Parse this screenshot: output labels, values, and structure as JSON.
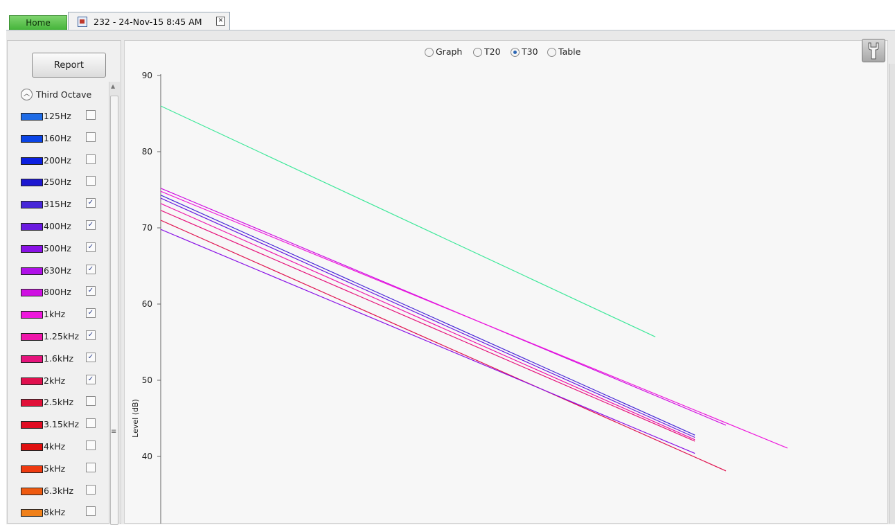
{
  "tabs": {
    "home_label": "Home",
    "document_label": "232 - 24-Nov-15 8:45 AM",
    "close_glyph": "✕"
  },
  "sidebar": {
    "report_label": "Report",
    "section_label": "Third Octave",
    "bands": [
      {
        "label": "125Hz",
        "color": "#1e6be6",
        "checked": false
      },
      {
        "label": "160Hz",
        "color": "#0a44e6",
        "checked": false
      },
      {
        "label": "200Hz",
        "color": "#0c20e0",
        "checked": false
      },
      {
        "label": "250Hz",
        "color": "#1d18d0",
        "checked": false
      },
      {
        "label": "315Hz",
        "color": "#4727d8",
        "checked": true
      },
      {
        "label": "400Hz",
        "color": "#6a1ae0",
        "checked": true
      },
      {
        "label": "500Hz",
        "color": "#8a12e6",
        "checked": true
      },
      {
        "label": "630Hz",
        "color": "#b010e8",
        "checked": true
      },
      {
        "label": "800Hz",
        "color": "#cf10e2",
        "checked": true
      },
      {
        "label": "1kHz",
        "color": "#ee18dc",
        "checked": true
      },
      {
        "label": "1.25kHz",
        "color": "#ee16aa",
        "checked": true
      },
      {
        "label": "1.6kHz",
        "color": "#e6147c",
        "checked": true
      },
      {
        "label": "2kHz",
        "color": "#e0104e",
        "checked": true
      },
      {
        "label": "2.5kHz",
        "color": "#e01038",
        "checked": false
      },
      {
        "label": "3.15kHz",
        "color": "#e00c22",
        "checked": false
      },
      {
        "label": "4kHz",
        "color": "#e01010",
        "checked": false
      },
      {
        "label": "5kHz",
        "color": "#ee3a10",
        "checked": false
      },
      {
        "label": "6.3kHz",
        "color": "#ee5a10",
        "checked": false
      },
      {
        "label": "8kHz",
        "color": "#f0801a",
        "checked": false
      }
    ]
  },
  "view_options": {
    "options": [
      "Graph",
      "T20",
      "T30",
      "Table"
    ],
    "selected": "T30"
  },
  "chart_data": {
    "type": "line",
    "ylabel": "Level (dB)",
    "ylim": [
      30,
      90
    ],
    "yticks": [
      40,
      50,
      60,
      70,
      80,
      90
    ],
    "grid": false,
    "series": [
      {
        "color": "#3ee89a",
        "x": [
          0.0,
          0.7
        ],
        "y": [
          86.0,
          55.7
        ]
      },
      {
        "color": "#cf10e2",
        "x": [
          0.0,
          0.8
        ],
        "y": [
          75.2,
          44.1
        ]
      },
      {
        "color": "#ee18dc",
        "x": [
          0.0,
          0.887
        ],
        "y": [
          74.8,
          41.1
        ]
      },
      {
        "color": "#4727d8",
        "x": [
          0.0,
          0.756
        ],
        "y": [
          74.3,
          42.8
        ]
      },
      {
        "color": "#6a1ae0",
        "x": [
          0.0,
          0.756
        ],
        "y": [
          73.9,
          42.5
        ]
      },
      {
        "color": "#ee16aa",
        "x": [
          0.0,
          0.756
        ],
        "y": [
          73.2,
          42.2
        ]
      },
      {
        "color": "#e6147c",
        "x": [
          0.0,
          0.756
        ],
        "y": [
          72.3,
          42.0
        ]
      },
      {
        "color": "#e0104e",
        "x": [
          0.0,
          0.8
        ],
        "y": [
          71.0,
          38.1
        ]
      },
      {
        "color": "#8a12e6",
        "x": [
          0.0,
          0.756
        ],
        "y": [
          69.8,
          40.4
        ]
      }
    ]
  }
}
